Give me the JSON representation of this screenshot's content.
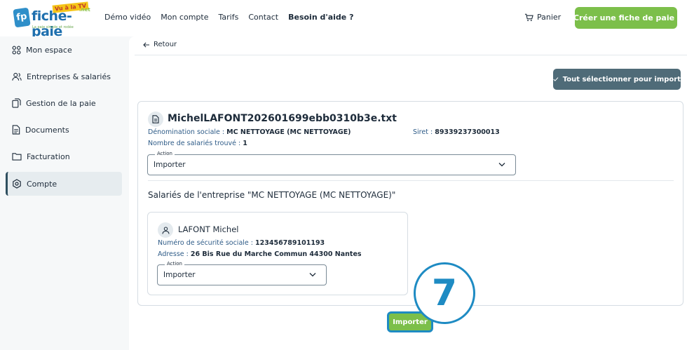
{
  "header": {
    "logo": {
      "word": "fiche-paie",
      "badge": "Vu à la TV",
      "net": ".net",
      "tagline": "La paie simple et rodée",
      "mark": "fp"
    },
    "nav": [
      "Démo vidéo",
      "Mon compte",
      "Tarifs",
      "Contact",
      "Besoin d'aide ?"
    ],
    "cart_label": "Panier",
    "create_label": "Créer une fiche de paie"
  },
  "sidebar": {
    "items": [
      {
        "label": "Mon espace",
        "icon": "grid-icon"
      },
      {
        "label": "Entreprises & salariés",
        "icon": "users-icon"
      },
      {
        "label": "Gestion de la paie",
        "icon": "copy-icon"
      },
      {
        "label": "Documents",
        "icon": "document-icon"
      },
      {
        "label": "Facturation",
        "icon": "folder-icon"
      },
      {
        "label": "Compte",
        "icon": "settings-icon"
      }
    ],
    "active": "Compte"
  },
  "main": {
    "back_label": "Retour",
    "select_all_label": "Tout sélectionner pour import",
    "file": {
      "name": "MichelLAFONT202601699ebb0310b3e.txt",
      "denomination_label": "Dénomination sociale :",
      "denomination_value": "MC NETTOYAGE (MC NETTOYAGE)",
      "siret_label": "Siret :",
      "siret_value": "89339237300013",
      "count_label": "Nombre de salariés trouvé :",
      "count_value": "1",
      "action_label": "Action",
      "action_value": "Importer"
    },
    "section_title": "Salariés de l'entreprise \"MC NETTOYAGE (MC NETTOYAGE)\"",
    "employee": {
      "name": "LAFONT Michel",
      "ssn_label": "Numéro de sécurité sociale :",
      "ssn_value": "123456789101193",
      "address_label": "Adresse :",
      "address_value": "26 Bis Rue du Marche Commun 44300 Nantes",
      "action_label": "Action",
      "action_value": "Importer"
    },
    "import_label": "Importer",
    "step_number": "7"
  },
  "colors": {
    "accent_green": "#7cbf4a",
    "step_blue": "#1e8bc3",
    "slate": "#4f6b78"
  }
}
